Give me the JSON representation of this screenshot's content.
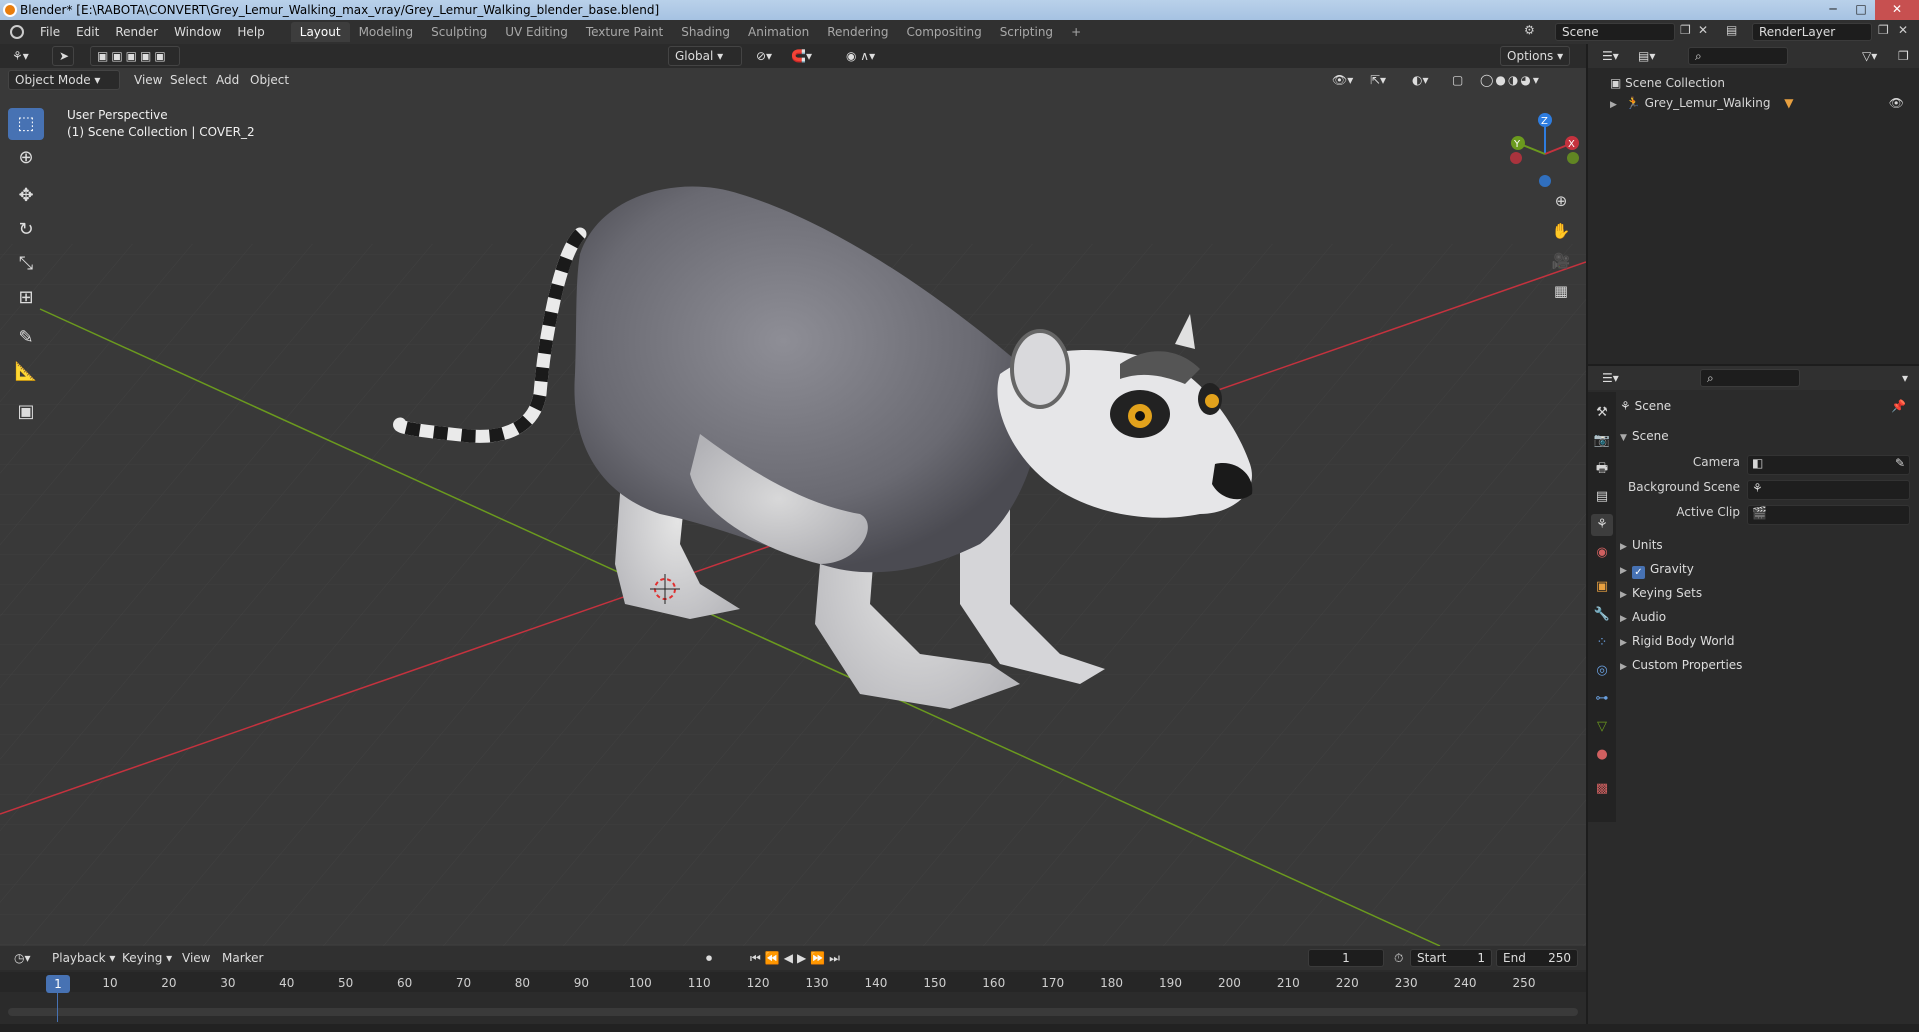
{
  "window": {
    "title": "Blender* [E:\\RABOTA\\CONVERT\\Grey_Lemur_Walking_max_vray/Grey_Lemur_Walking_blender_base.blend]"
  },
  "menu": [
    "File",
    "Edit",
    "Render",
    "Window",
    "Help"
  ],
  "workspaces": [
    "Layout",
    "Modeling",
    "Sculpting",
    "UV Editing",
    "Texture Paint",
    "Shading",
    "Animation",
    "Rendering",
    "Compositing",
    "Scripting"
  ],
  "active_workspace": "Layout",
  "scene_selector": {
    "value": "Scene"
  },
  "layer_selector": {
    "value": "RenderLayer"
  },
  "viewport": {
    "mode": "Object Mode",
    "menus": [
      "View",
      "Select",
      "Add",
      "Object"
    ],
    "transform": "Global",
    "options": "Options",
    "overlay_line1": "User Perspective",
    "overlay_line2": "(1) Scene Collection | COVER_2",
    "gizmo": {
      "z": "Z",
      "y": "Y",
      "x": "X"
    }
  },
  "outliner": {
    "root": "Scene Collection",
    "items": [
      {
        "label": "Grey_Lemur_Walking"
      }
    ]
  },
  "properties": {
    "context": "Scene",
    "section": "Scene",
    "fields": [
      {
        "label": "Camera",
        "value": ""
      },
      {
        "label": "Background Scene",
        "value": ""
      },
      {
        "label": "Active Clip",
        "value": ""
      }
    ],
    "panels": [
      {
        "label": "Units",
        "checkbox": false
      },
      {
        "label": "Gravity",
        "checkbox": true
      },
      {
        "label": "Keying Sets",
        "checkbox": false
      },
      {
        "label": "Audio",
        "checkbox": false
      },
      {
        "label": "Rigid Body World",
        "checkbox": false
      },
      {
        "label": "Custom Properties",
        "checkbox": false
      }
    ]
  },
  "timeline": {
    "menus": [
      "Playback",
      "Keying",
      "View",
      "Marker"
    ],
    "current_frame": "1",
    "start_label": "Start",
    "start": "1",
    "end_label": "End",
    "end": "250",
    "ticks": [
      "1",
      "10",
      "20",
      "30",
      "40",
      "50",
      "60",
      "70",
      "80",
      "90",
      "100",
      "110",
      "120",
      "130",
      "140",
      "150",
      "160",
      "170",
      "180",
      "190",
      "200",
      "210",
      "220",
      "230",
      "240",
      "250"
    ]
  },
  "colors": {
    "accent": "#4772b3",
    "x_axis": "#c5323e",
    "y_axis": "#6b9a1e",
    "z_axis": "#2e7de0"
  }
}
